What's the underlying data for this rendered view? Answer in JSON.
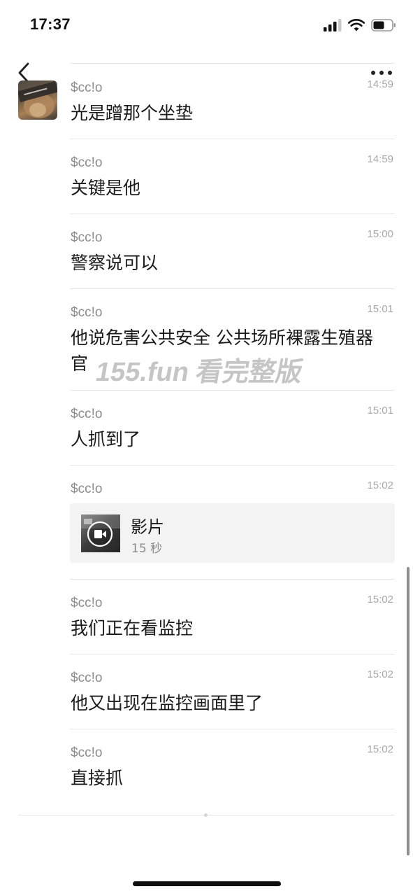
{
  "status_bar": {
    "time": "17:37"
  },
  "nav": {
    "back": "back-icon",
    "more": "more-icon"
  },
  "messages": [
    {
      "sender": "$cc!o",
      "time": "14:59",
      "text": "光是蹭那个坐垫"
    },
    {
      "sender": "$cc!o",
      "time": "14:59",
      "text": "关键是他"
    },
    {
      "sender": "$cc!o",
      "time": "15:00",
      "text": "警察说可以"
    },
    {
      "sender": "$cc!o",
      "time": "15:01",
      "text": "他说危害公共安全 公共场所裸露生殖器官"
    },
    {
      "sender": "$cc!o",
      "time": "15:01",
      "text": "人抓到了"
    },
    {
      "sender": "$cc!o",
      "time": "15:02",
      "video_title": "影片",
      "video_duration": "15 秒"
    },
    {
      "sender": "$cc!o",
      "time": "15:02",
      "text": "我们正在看监控"
    },
    {
      "sender": "$cc!o",
      "time": "15:02",
      "text": "他又出现在监控画面里了"
    },
    {
      "sender": "$cc!o",
      "time": "15:02",
      "text": "直接抓"
    }
  ],
  "watermark": "155.fun 看完整版"
}
